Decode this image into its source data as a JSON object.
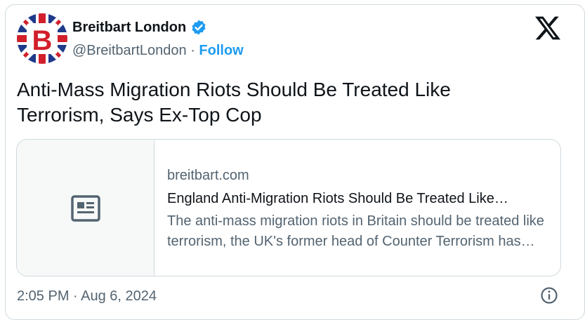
{
  "author": {
    "name": "Breitbart London",
    "handle": "@BreitbartLondon",
    "separator": " · ",
    "follow_label": "Follow",
    "avatar_icon": "breitbart-union-jack-logo",
    "verified_icon": "verified-badge-icon"
  },
  "tweet": {
    "text": "Anti-Mass Migration Riots Should Be Treated Like Terrorism, Says Ex-Top Cop"
  },
  "link_card": {
    "domain": "breitbart.com",
    "title": "England Anti-Migration Riots Should Be Treated Like…",
    "description": "The anti-mass migration riots in Britain should be treated like terrorism, the UK's former head of Counter Terrorism has said.",
    "thumbnail_icon": "article-icon"
  },
  "footer": {
    "timestamp": "2:05 PM · Aug 6, 2024",
    "info_icon": "info-icon"
  },
  "colors": {
    "text": "#0f1419",
    "secondary": "#536471",
    "accent": "#1d9bf0",
    "border": "#cfd9de"
  }
}
